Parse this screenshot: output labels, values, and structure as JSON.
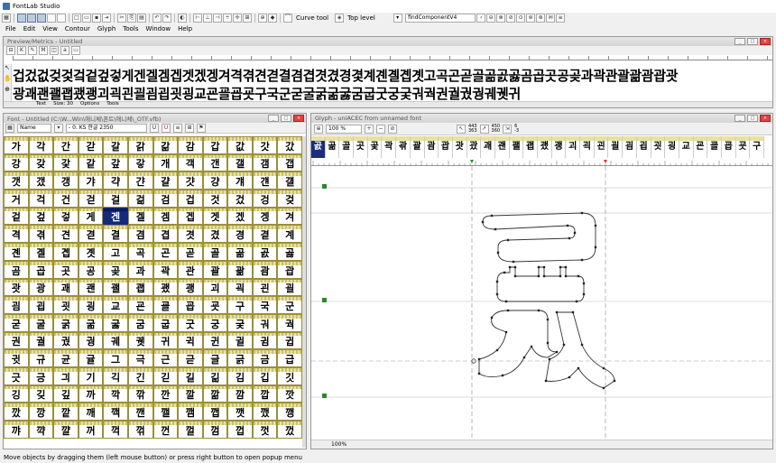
{
  "app": {
    "title": "FontLab Studio"
  },
  "toolbar": {
    "curve_tool": "Curve tool",
    "top_level": "Top level",
    "find_component": "findComponentV4"
  },
  "menu": [
    "File",
    "Edit",
    "View",
    "Contour",
    "Glyph",
    "Tools",
    "Window",
    "Help"
  ],
  "preview": {
    "title": "Preview/Metrics - Untitled",
    "line1": "겁겄겂겆겇겈겉겊겋게겐겔겜겝겟겠겡겨격겪견겯결겸겹겻겼경겿계곈곌곕곗고곡곤곧골곪곬곯곰곱곳공곶과곽관괄괆괌괍괏",
    "line2": "광괘괜괠괩괬괭괴괵괸괼굄굅굇굉교굔굘굡굣구국군굳굴굵굶굻굼굽굿궁궂궈궉권궐궜궝궤궷귀",
    "opt_text": "Text",
    "opt_size": "Size: 30",
    "opt_options": "Options",
    "opt_tools": "Tools"
  },
  "fontwin": {
    "title": "Font - Untitled (C:\\W...Win\\애니체\\폰트\\애니체\\_OTF.vfb)",
    "sort": "Name",
    "codepage": "- 0. KS 한글 2350",
    "glyphs": [
      "가",
      "각",
      "간",
      "갇",
      "갈",
      "갉",
      "갊",
      "감",
      "갑",
      "값",
      "갓",
      "갔",
      "강",
      "갖",
      "갗",
      "같",
      "갚",
      "갛",
      "개",
      "객",
      "갠",
      "갤",
      "갬",
      "갭",
      "갯",
      "갰",
      "갱",
      "갸",
      "갹",
      "갼",
      "걀",
      "걋",
      "걍",
      "걔",
      "걘",
      "걜",
      "거",
      "걱",
      "건",
      "걷",
      "걸",
      "걺",
      "검",
      "겁",
      "것",
      "겄",
      "겅",
      "겆",
      "겉",
      "겊",
      "겋",
      "게",
      "겐",
      "겔",
      "겜",
      "겝",
      "겟",
      "겠",
      "겡",
      "겨",
      "격",
      "겪",
      "견",
      "겯",
      "결",
      "겸",
      "겹",
      "겻",
      "겼",
      "경",
      "곁",
      "계",
      "곈",
      "곌",
      "곕",
      "곗",
      "고",
      "곡",
      "곤",
      "곧",
      "골",
      "곪",
      "곬",
      "곯",
      "곰",
      "곱",
      "곳",
      "공",
      "곶",
      "과",
      "곽",
      "관",
      "괄",
      "괆",
      "괌",
      "괍",
      "괏",
      "광",
      "괘",
      "괜",
      "괠",
      "괩",
      "괬",
      "괭",
      "괴",
      "괵",
      "괸",
      "괼",
      "굄",
      "굅",
      "굇",
      "굉",
      "교",
      "굔",
      "굘",
      "굡",
      "굣",
      "구",
      "국",
      "군",
      "굳",
      "굴",
      "굵",
      "굶",
      "굻",
      "굼",
      "굽",
      "굿",
      "궁",
      "궂",
      "궈",
      "궉",
      "권",
      "궐",
      "궜",
      "궝",
      "궤",
      "궷",
      "귀",
      "귁",
      "귄",
      "귈",
      "귐",
      "귑",
      "귓",
      "규",
      "균",
      "귤",
      "그",
      "극",
      "근",
      "귿",
      "글",
      "긁",
      "금",
      "급",
      "긋",
      "긍",
      "긔",
      "기",
      "긱",
      "긴",
      "긷",
      "길",
      "긺",
      "김",
      "깁",
      "깃",
      "깅",
      "깆",
      "깊",
      "까",
      "깍",
      "깎",
      "깐",
      "깔",
      "깖",
      "깜",
      "깝",
      "깟",
      "깠",
      "깡",
      "깥",
      "깨",
      "깩",
      "깬",
      "깰",
      "깸",
      "깹",
      "깻",
      "깼",
      "깽",
      "꺄",
      "꺅",
      "꺌",
      "꺼",
      "꺽",
      "꺾",
      "껀",
      "껄",
      "껌",
      "껍",
      "껏",
      "껐",
      "껑",
      "께",
      "껙",
      "껜",
      "껨",
      "껫",
      "껭",
      "껴",
      "껸",
      "껼",
      "꼇",
      "꼈",
      "꼍",
      "꼐",
      "꼬",
      "꼭",
      "꼰",
      "꼲",
      "꼴",
      "꼼",
      "꼽",
      "꼿",
      "꽁",
      "꽂",
      "꽃",
      "꽈",
      "꽉",
      "꽐",
      "꽜",
      "꽝",
      "꽤",
      "꽥",
      "꽹",
      "꾀",
      "꾄",
      "꾈",
      "꾐",
      "꾑",
      "꾕",
      "꾜",
      "꾸",
      "꾹",
      "꾼",
      "꿀",
      "꿇",
      "꿈",
      "꿉",
      "꿋",
      "꿍",
      "꿎",
      "꿔",
      "꿜",
      "꿨",
      "꿩",
      "꿰",
      "꿱",
      "꿴",
      "꿸",
      "뀀",
      "뀁",
      "뀄",
      "뀌",
      "뀐",
      "뀔",
      "뀜",
      "뀝",
      "뀨",
      "끄",
      "끅",
      "끈",
      "끊",
      "끌",
      "끎",
      "끓",
      "끔",
      "끕",
      "끗",
      "끙"
    ],
    "selected_index": 52
  },
  "glyphwin": {
    "title": "Glyph - uniACEC from unnamed font",
    "zoom": "100 %",
    "coord1a": "443",
    "coord1b": "363",
    "coord2a": "450",
    "coord2b": "360",
    "coord3a": "6",
    "coord3b": "-3",
    "strip": [
      "곬",
      "곪",
      "골",
      "곳",
      "곷",
      "곽",
      "곾",
      "괄",
      "괌",
      "괍",
      "괏",
      "괐",
      "괘",
      "괜",
      "괠",
      "괩",
      "괬",
      "괭",
      "괴",
      "괵",
      "괸",
      "괼",
      "굄",
      "굅",
      "굇",
      "굉",
      "교",
      "굔",
      "굘",
      "굡",
      "굣",
      "구"
    ],
    "selected_strip": 0,
    "bottom_zoom": "100%"
  },
  "status": "Move objects by dragging them (left mouse button) or press right button to open popup menu"
}
